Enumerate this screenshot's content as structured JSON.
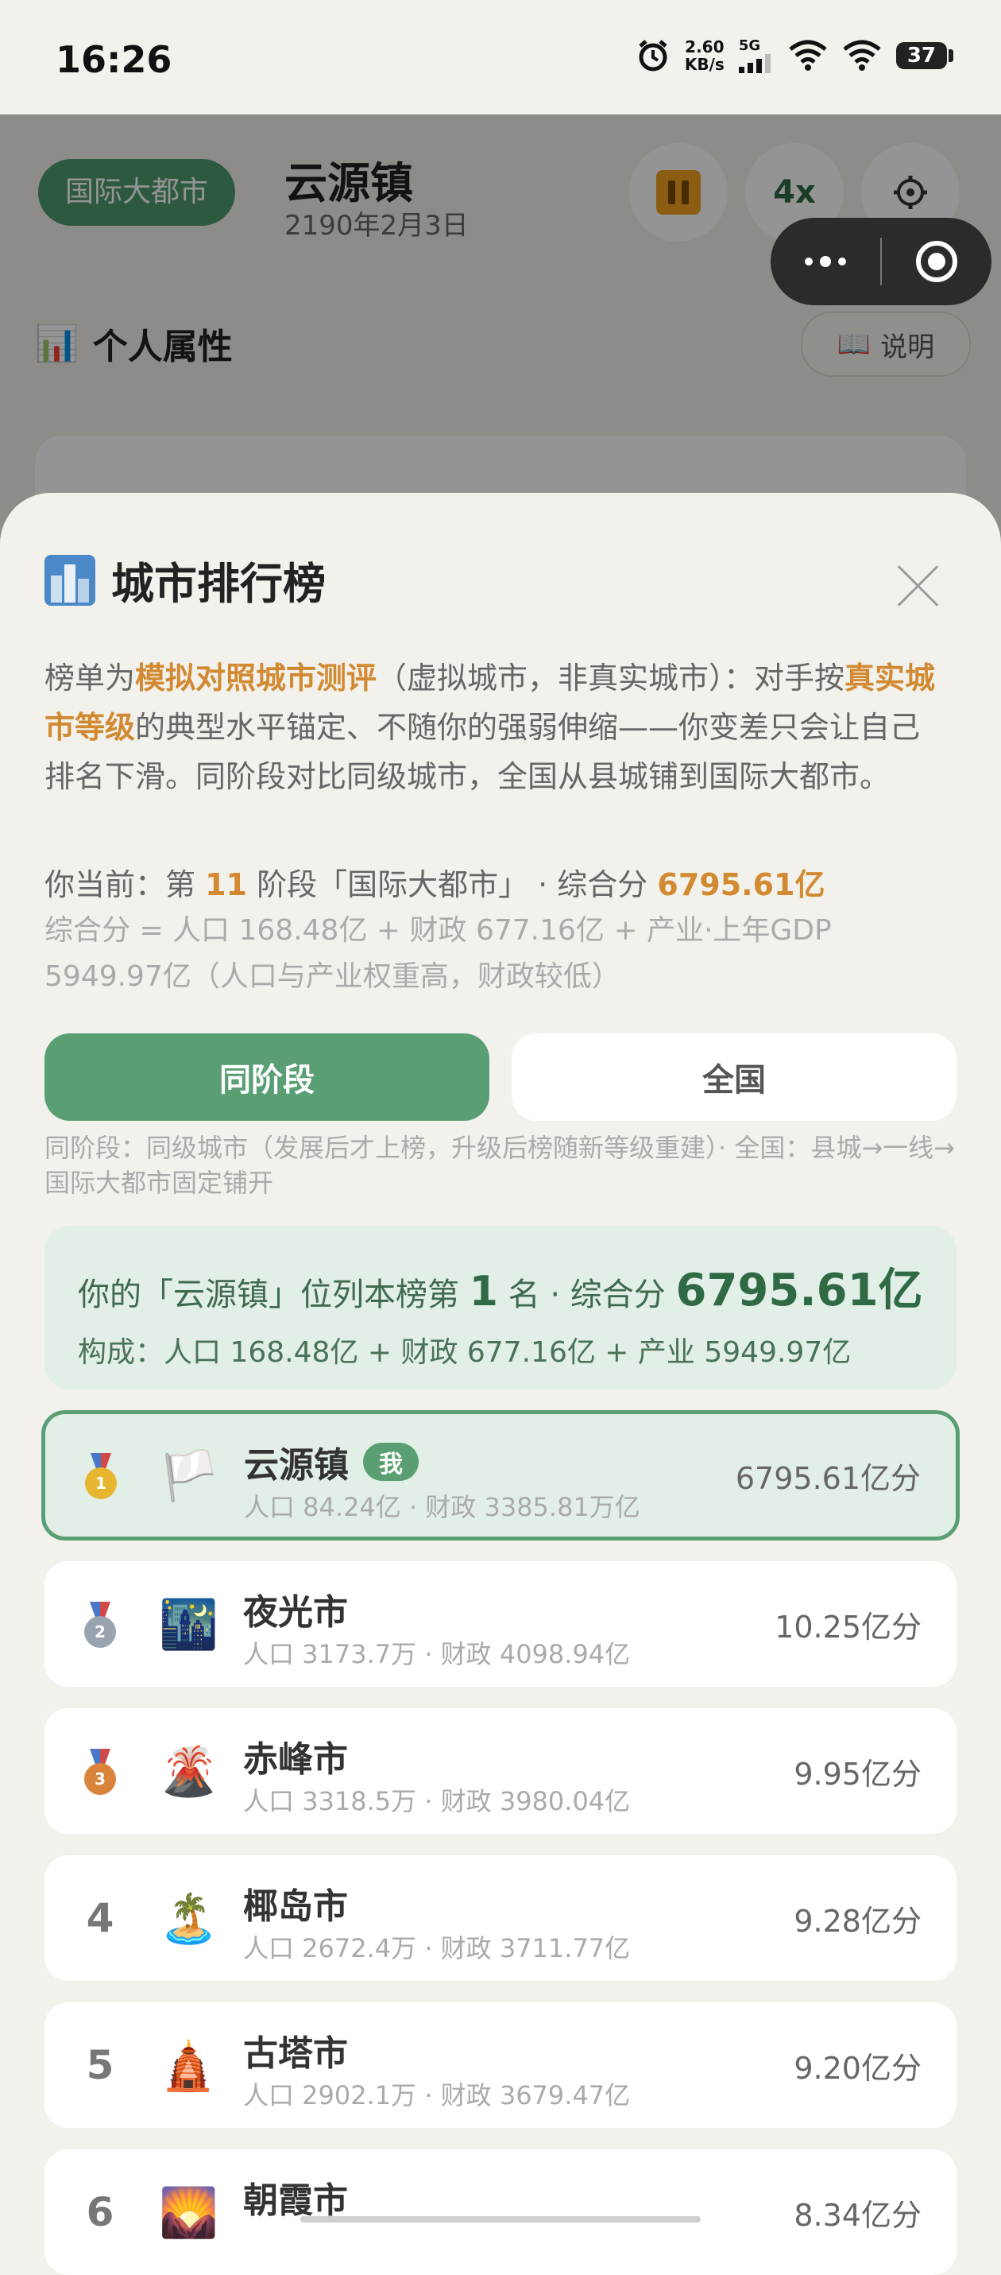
{
  "status_bar": {
    "time": "16:26",
    "net_speed": "2.60",
    "net_unit": "KB/s",
    "network": "5G",
    "battery": "37"
  },
  "header": {
    "tier_badge": "国际大都市",
    "city_name": "云源镇",
    "date": "2190年2月3日",
    "speed": "4x"
  },
  "attributes": {
    "title": "个人属性",
    "help_label": "说明"
  },
  "sheet": {
    "title": "城市排行榜",
    "intro": {
      "p1": "榜单为",
      "h1": "模拟对照城市测评",
      "p2": "（虚拟城市，非真实城市）：对手按",
      "h2": "真实城市等级",
      "p3": "的典型水平锚定、不随你的强弱伸缩——你变差只会让自己排名下滑。同阶段对比同级城市，全国从县城铺到国际大都市。"
    },
    "current": {
      "prefix": "你当前：第 ",
      "stage": "11",
      "middle": " 阶段「国际大都市」 · 综合分 ",
      "score": "6795.61亿"
    },
    "formula": "综合分 = 人口 168.48亿 + 财政 677.16亿 + 产业·上年GDP 5949.97亿（人口与产业权重高，财政较低）",
    "tabs": [
      "同阶段",
      "全国"
    ],
    "tab_note": "同阶段：同级城市（发展后才上榜，升级后榜随新等级重建）· 全国：县城→一线→国际大都市固定铺开",
    "summary": {
      "pre": "你的「云源镇」位列本榜第 ",
      "rank": "1",
      "mid": " 名 · 综合分 ",
      "score": "6795.61亿",
      "composition": "构成：人口 168.48亿 + 财政 677.16亿 + 产业 5949.97亿"
    },
    "me_badge": "我",
    "rows": [
      {
        "rank": "1",
        "icon": "🏳️",
        "name": "云源镇",
        "sub": "人口 84.24亿 · 财政 3385.81万亿",
        "score": "6795.61亿分"
      },
      {
        "rank": "2",
        "icon": "🌃",
        "name": "夜光市",
        "sub": "人口 3173.7万 · 财政 4098.94亿",
        "score": "10.25亿分"
      },
      {
        "rank": "3",
        "icon": "🌋",
        "name": "赤峰市",
        "sub": "人口 3318.5万 · 财政 3980.04亿",
        "score": "9.95亿分"
      },
      {
        "rank": "4",
        "icon": "🏝️",
        "name": "椰岛市",
        "sub": "人口 2672.4万 · 财政 3711.77亿",
        "score": "9.28亿分"
      },
      {
        "rank": "5",
        "icon": "🛕",
        "name": "古塔市",
        "sub": "人口 2902.1万 · 财政 3679.47亿",
        "score": "9.20亿分"
      },
      {
        "rank": "6",
        "icon": "🌄",
        "name": "朝霞市",
        "sub": "",
        "score": "8.34亿分"
      }
    ],
    "medal_colors": [
      "#e8b530",
      "#9aa4b0",
      "#d9833b"
    ]
  }
}
